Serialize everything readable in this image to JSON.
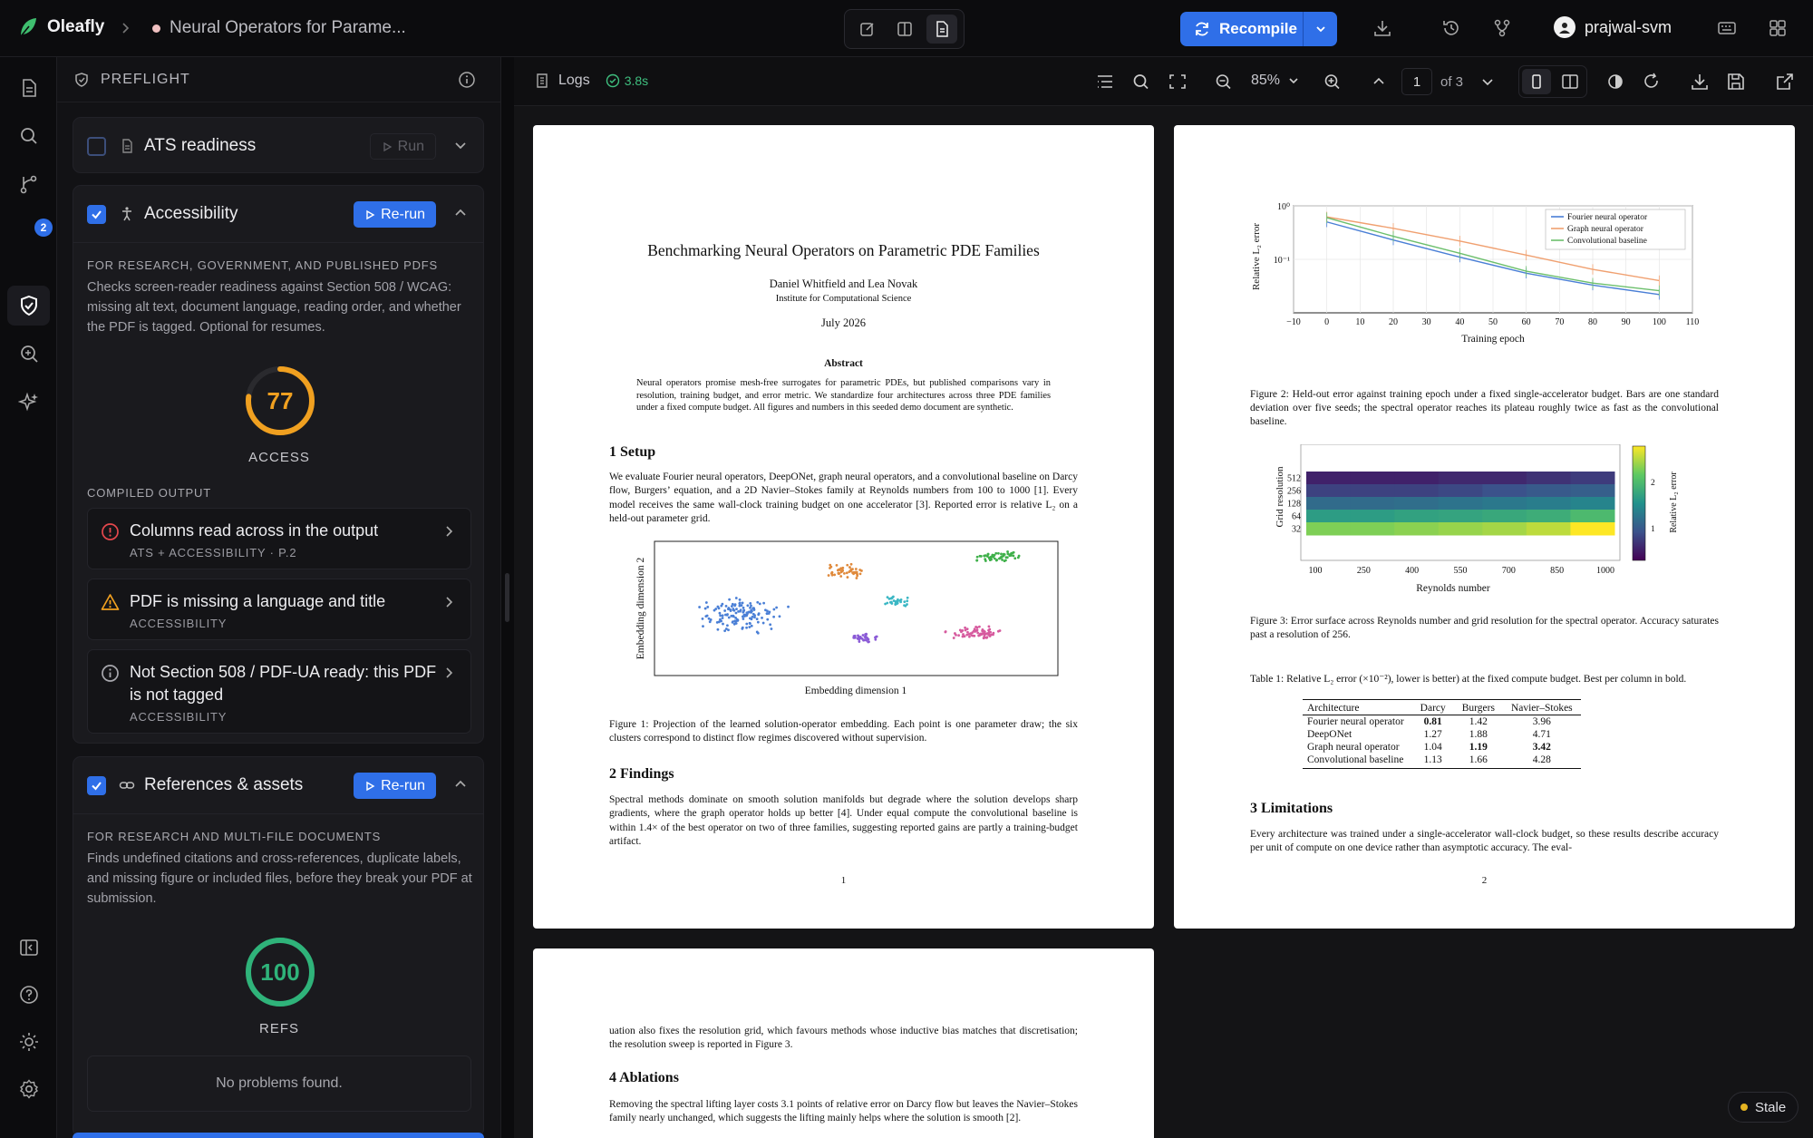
{
  "app": {
    "name": "Oleafly",
    "doc_title": "Neural Operators for Parame...",
    "recompile_label": "Recompile",
    "user": "prajwal-svm"
  },
  "preflight": {
    "title": "PREFLIGHT",
    "ats": {
      "name": "ATS readiness",
      "run_label": "Run"
    },
    "accessibility": {
      "name": "Accessibility",
      "rerun_label": "Re-run",
      "section": "FOR RESEARCH, GOVERNMENT, AND PUBLISHED PDFS",
      "description": "Checks screen-reader readiness against Section 508 / WCAG: missing alt text, document language, reading order, and whether the PDF is tagged. Optional for resumes.",
      "score": 77,
      "score_label": "ACCESS",
      "score_color": "#f0a020",
      "compiled_label": "COMPILED OUTPUT",
      "issues": [
        {
          "title": "Columns read across in the output",
          "sub": "ATS + ACCESSIBILITY  · P.2",
          "icon": "error-circle-icon",
          "color": "#e5484d"
        },
        {
          "title": "PDF is missing a language and title",
          "sub": "ACCESSIBILITY",
          "icon": "warning-triangle-icon",
          "color": "#f0a020"
        },
        {
          "title": "Not Section 508 / PDF-UA ready: this PDF is not tagged",
          "sub": "ACCESSIBILITY",
          "icon": "info-circle-icon",
          "color": "#a8a8ae"
        }
      ]
    },
    "refs": {
      "name": "References & assets",
      "rerun_label": "Re-run",
      "section": "FOR RESEARCH AND MULTI-FILE DOCUMENTS",
      "description": "Finds undefined citations and cross-references, duplicate labels, and missing figure or included files, before they break your PDF at submission.",
      "score": 100,
      "score_label": "REFS",
      "score_color": "#2fb37a",
      "empty": "No problems found."
    }
  },
  "viewer": {
    "logs_label": "Logs",
    "compile_time": "3.8s",
    "zoom": "85%",
    "page": "1",
    "page_of": "of 3",
    "stale_label": "Stale"
  },
  "paper": {
    "title": "Benchmarking Neural Operators on Parametric PDE Families",
    "authors": "Daniel Whitfield and Lea Novak",
    "affiliation": "Institute for Computational Science",
    "date": "July 2026",
    "abstract_heading": "Abstract",
    "abstract": "Neural operators promise mesh-free surrogates for parametric PDEs, but published comparisons vary in resolution, training budget, and error metric. We standardize four architectures across three PDE families under a fixed compute budget. All figures and numbers in this seeded demo document are synthetic.",
    "s1_heading": "1   Setup",
    "s1_text": "We evaluate Fourier neural operators, DeepONet, graph neural operators, and a convolutional baseline on Darcy flow, Burgers’ equation, and a 2D Navier–Stokes family at Reynolds numbers from 100 to 1000 [1]. Every model receives the same wall-clock training budget on one accelerator [3]. Reported error is relative L₂ on a held-out parameter grid.",
    "fig1_caption": "Figure 1: Projection of the learned solution-operator embedding. Each point is one parameter draw; the six clusters correspond to distinct flow regimes discovered without supervision.",
    "s2_heading": "2   Findings",
    "s2_text": "Spectral methods dominate on smooth solution manifolds but degrade where the solution develops sharp gradients, where the graph operator holds up better [4]. Under equal compute the convolutional baseline is within 1.4× of the best operator on two of three families, suggesting reported gains are partly a training-budget artifact.",
    "page1_num": "1",
    "fig2_caption": "Figure 2: Held-out error against training epoch under a fixed single-accelerator budget. Bars are one standard deviation over five seeds; the spectral operator reaches its plateau roughly twice as fast as the convolutional baseline.",
    "fig3_caption": "Figure 3: Error surface across Reynolds number and grid resolution for the spectral operator. Accuracy saturates past a resolution of 256.",
    "table_caption": "Table 1: Relative L₂ error (×10⁻²), lower is better) at the fixed compute budget. Best per column in bold.",
    "table": {
      "headers": [
        "Architecture",
        "Darcy",
        "Burgers",
        "Navier–Stokes"
      ],
      "rows": [
        [
          "Fourier neural operator",
          "0.81",
          "1.42",
          "3.96"
        ],
        [
          "DeepONet",
          "1.27",
          "1.88",
          "4.71"
        ],
        [
          "Graph neural operator",
          "1.04",
          "1.19",
          "3.42"
        ],
        [
          "Convolutional baseline",
          "1.13",
          "1.66",
          "4.28"
        ]
      ]
    },
    "s3_heading": "3   Limitations",
    "s3_text": "Every architecture was trained under a single-accelerator wall-clock budget, so these results describe accuracy per unit of compute on one device rather than asymptotic accuracy. The eval-",
    "page2_num": "2",
    "p3_text": "uation also fixes the resolution grid, which favours methods whose inductive bias matches that discretisation; the resolution sweep is reported in Figure 3.",
    "s4_heading": "4   Ablations",
    "s4_text": "Removing the spectral lifting layer costs 3.1 points of relative error on Darcy flow but leaves the Navier–Stokes family nearly unchanged, which suggests the lifting mainly helps where the solution is smooth [2]."
  },
  "chart_data": [
    {
      "type": "scatter",
      "xlabel": "Embedding dimension 1",
      "ylabel": "Embedding dimension 2",
      "series": [
        {
          "color": "#4a7fd6",
          "center": [
            0.22,
            0.55
          ],
          "spread": [
            0.14,
            0.16
          ],
          "n": 140
        },
        {
          "color": "#e08a3c",
          "center": [
            0.48,
            0.22
          ],
          "spread": [
            0.06,
            0.07
          ],
          "n": 50
        },
        {
          "color": "#3fb04a",
          "center": [
            0.85,
            0.12
          ],
          "spread": [
            0.07,
            0.06
          ],
          "n": 60
        },
        {
          "color": "#3bb7c4",
          "center": [
            0.6,
            0.45
          ],
          "spread": [
            0.04,
            0.06
          ],
          "n": 30
        },
        {
          "color": "#8a5ad6",
          "center": [
            0.52,
            0.72
          ],
          "spread": [
            0.05,
            0.05
          ],
          "n": 35
        },
        {
          "color": "#d65a9e",
          "center": [
            0.8,
            0.68
          ],
          "spread": [
            0.09,
            0.07
          ],
          "n": 70
        }
      ]
    },
    {
      "type": "line",
      "xlabel": "Training epoch",
      "ylabel": "Relative L2 error",
      "log_y": true,
      "xlim": [
        -10,
        110
      ],
      "ylim": [
        0.01,
        1
      ],
      "x_ticks": [
        -10,
        0,
        10,
        20,
        30,
        40,
        50,
        60,
        70,
        80,
        90,
        100,
        110
      ],
      "y_tick_labels": [
        "10⁰",
        "10⁻¹"
      ],
      "series": [
        {
          "name": "Fourier neural operator",
          "color": "#4a7fd6",
          "x": [
            0,
            20,
            40,
            60,
            80,
            100
          ],
          "y": [
            0.5,
            0.23,
            0.11,
            0.055,
            0.033,
            0.022
          ]
        },
        {
          "name": "Graph neural operator",
          "color": "#f0a070",
          "x": [
            0,
            20,
            40,
            60,
            80,
            100
          ],
          "y": [
            0.62,
            0.38,
            0.22,
            0.12,
            0.065,
            0.04
          ]
        },
        {
          "name": "Convolutional baseline",
          "color": "#6cbf6c",
          "x": [
            0,
            20,
            40,
            60,
            80,
            100
          ],
          "y": [
            0.6,
            0.27,
            0.13,
            0.06,
            0.036,
            0.026
          ]
        }
      ],
      "grid": true,
      "legend": "top-right"
    },
    {
      "type": "heatmap",
      "xlabel": "Reynolds number",
      "ylabel": "Grid resolution",
      "colorbar_label": "Relative L2 error",
      "x_ticks": [
        100,
        250,
        400,
        550,
        700,
        850,
        1000
      ],
      "y_ticks": [
        512,
        256,
        128,
        64,
        32
      ],
      "colorbar_ticks": [
        2,
        1
      ],
      "rows": [
        [
          0.1,
          0.1,
          0.1,
          0.12,
          0.12,
          0.15,
          0.18
        ],
        [
          0.2,
          0.2,
          0.2,
          0.22,
          0.25,
          0.28,
          0.3
        ],
        [
          0.35,
          0.35,
          0.36,
          0.38,
          0.4,
          0.42,
          0.45
        ],
        [
          0.55,
          0.55,
          0.57,
          0.58,
          0.6,
          0.62,
          0.68
        ],
        [
          0.8,
          0.8,
          0.82,
          0.84,
          0.86,
          0.9,
          1.0
        ]
      ]
    }
  ]
}
